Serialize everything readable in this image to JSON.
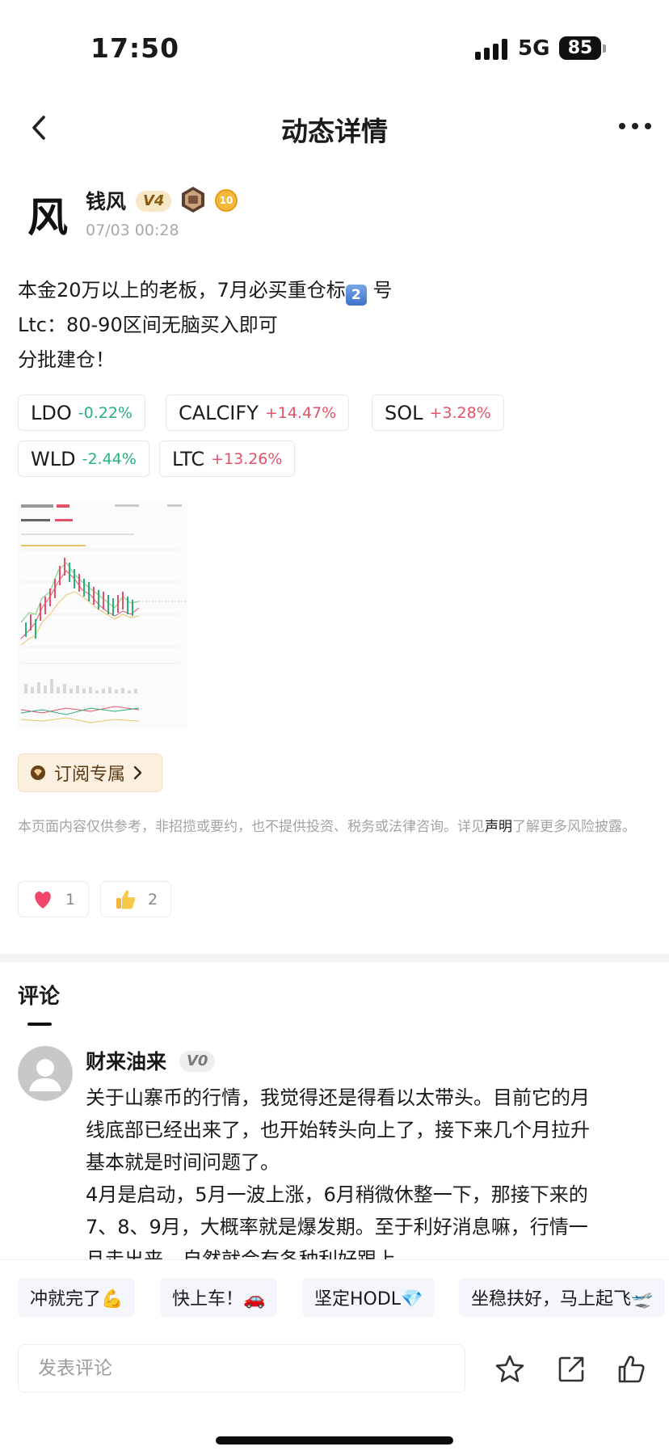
{
  "status_bar": {
    "time": "17:50",
    "network": "5G",
    "battery": "85"
  },
  "nav": {
    "title": "动态详情"
  },
  "author": {
    "avatar_glyph": "风",
    "name": "钱风",
    "vip_badge": "V4",
    "level_badge": "10",
    "time": "07/03 00:28"
  },
  "post": {
    "line1_prefix": "本金20万以上的老板，7月必买重仓标",
    "line1_emoji": "2",
    "line1_suffix": " 号",
    "line2": "Ltc：80-90区间无脑买入即可",
    "line3": "分批建仓！"
  },
  "coins": [
    {
      "symbol": "LDO",
      "change": "-0.22%",
      "direction": "down"
    },
    {
      "symbol": "CALCIFY",
      "change": "+14.47%",
      "direction": "up"
    },
    {
      "symbol": "SOL",
      "change": "+3.28%",
      "direction": "up"
    },
    {
      "symbol": "WLD",
      "change": "-2.44%",
      "direction": "down"
    },
    {
      "symbol": "LTC",
      "change": "+13.26%",
      "direction": "up"
    }
  ],
  "subscribe": {
    "label": "订阅专属"
  },
  "disclaimer": {
    "text_before": "本页面内容仅供参考，非招揽或要约，也不提供投资、税务或法律咨询。详见",
    "link": "声明",
    "text_after": "了解更多风险披露。"
  },
  "reactions": {
    "like_count": "1",
    "thumbs_count": "2"
  },
  "comments_section": {
    "heading": "评论"
  },
  "comment": {
    "author": "财来油来",
    "badge": "V0",
    "lines": [
      "关于山寨币的行情，我觉得还是得看以太带头。目前它的月",
      "线底部已经出来了，也开始转头向上了，接下来几个月拉升",
      "基本就是时间问题了。",
      "4月是启动，5月一波上涨，6月稍微休整一下，那接下来的",
      "7、8、9月，大概率就是爆发期。至于利好消息嘛，行情一",
      "旦走出来，自然就会有各种利好跟上"
    ]
  },
  "quick_replies": [
    "冲就完了💪",
    "快上车！🚗",
    "坚定HODL💎",
    "坐稳扶好，马上起飞🛫"
  ],
  "comment_input": {
    "placeholder": "发表评论"
  },
  "colors": {
    "up": "#e4526a",
    "down": "#29b07b",
    "subscribe_bg": "#fbf0df",
    "vip_badge_bg": "#f6e7c6"
  }
}
